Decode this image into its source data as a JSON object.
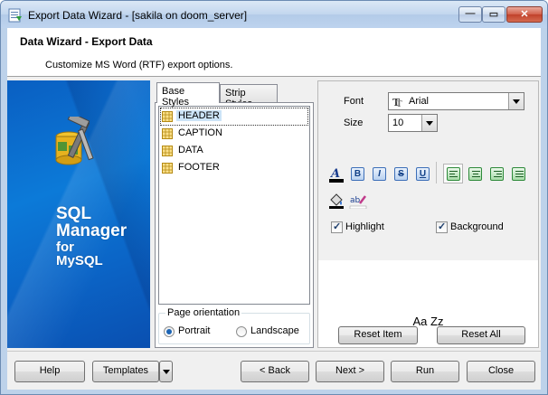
{
  "window": {
    "title": "Export Data Wizard - [sakila on doom_server]",
    "minimize_symbol": "—",
    "maximize_symbol": "▭",
    "close_symbol": "✕"
  },
  "header": {
    "title": "Data Wizard - Export Data",
    "subtitle": "Customize MS Word (RTF) export options."
  },
  "sidebar": {
    "brand_line1": "SQL",
    "brand_line2": "Manager",
    "brand_line3": "for",
    "brand_line4": "MySQL"
  },
  "tabs": [
    {
      "label": "Base Styles",
      "active": true
    },
    {
      "label": "Strip Styles",
      "active": false
    }
  ],
  "styles_list": [
    "HEADER",
    "CAPTION",
    "DATA",
    "FOOTER"
  ],
  "selected_style": "HEADER",
  "page_orientation": {
    "legend": "Page orientation",
    "options": [
      "Portrait",
      "Landscape"
    ],
    "selected": "Portrait"
  },
  "props": {
    "font_label": "Font",
    "font_value": "Arial",
    "size_label": "Size",
    "size_value": "10",
    "format_buttons": [
      "font-color",
      "bold",
      "italic",
      "strikeout",
      "underline"
    ],
    "format_glyphs": {
      "bold": "B",
      "italic": "I",
      "strikeout": "S",
      "underline": "U",
      "font_color": "A"
    },
    "align_buttons": [
      "align-left",
      "align-center",
      "align-right",
      "align-justify"
    ],
    "highlight_label": "Highlight",
    "background_label": "Background",
    "highlight_checked": true,
    "background_checked": true,
    "sample_text": "Aa Zz",
    "reset_item": "Reset Item",
    "reset_all": "Reset All"
  },
  "footer": {
    "help": "Help",
    "templates": "Templates",
    "back": "< Back",
    "next": "Next >",
    "run": "Run",
    "close": "Close"
  },
  "colors": {
    "title_gradient_top": "#dbe8f6",
    "sidebar_blue": "#0c7ad8",
    "close_red": "#c0412a",
    "selection": "#cce4f7"
  }
}
